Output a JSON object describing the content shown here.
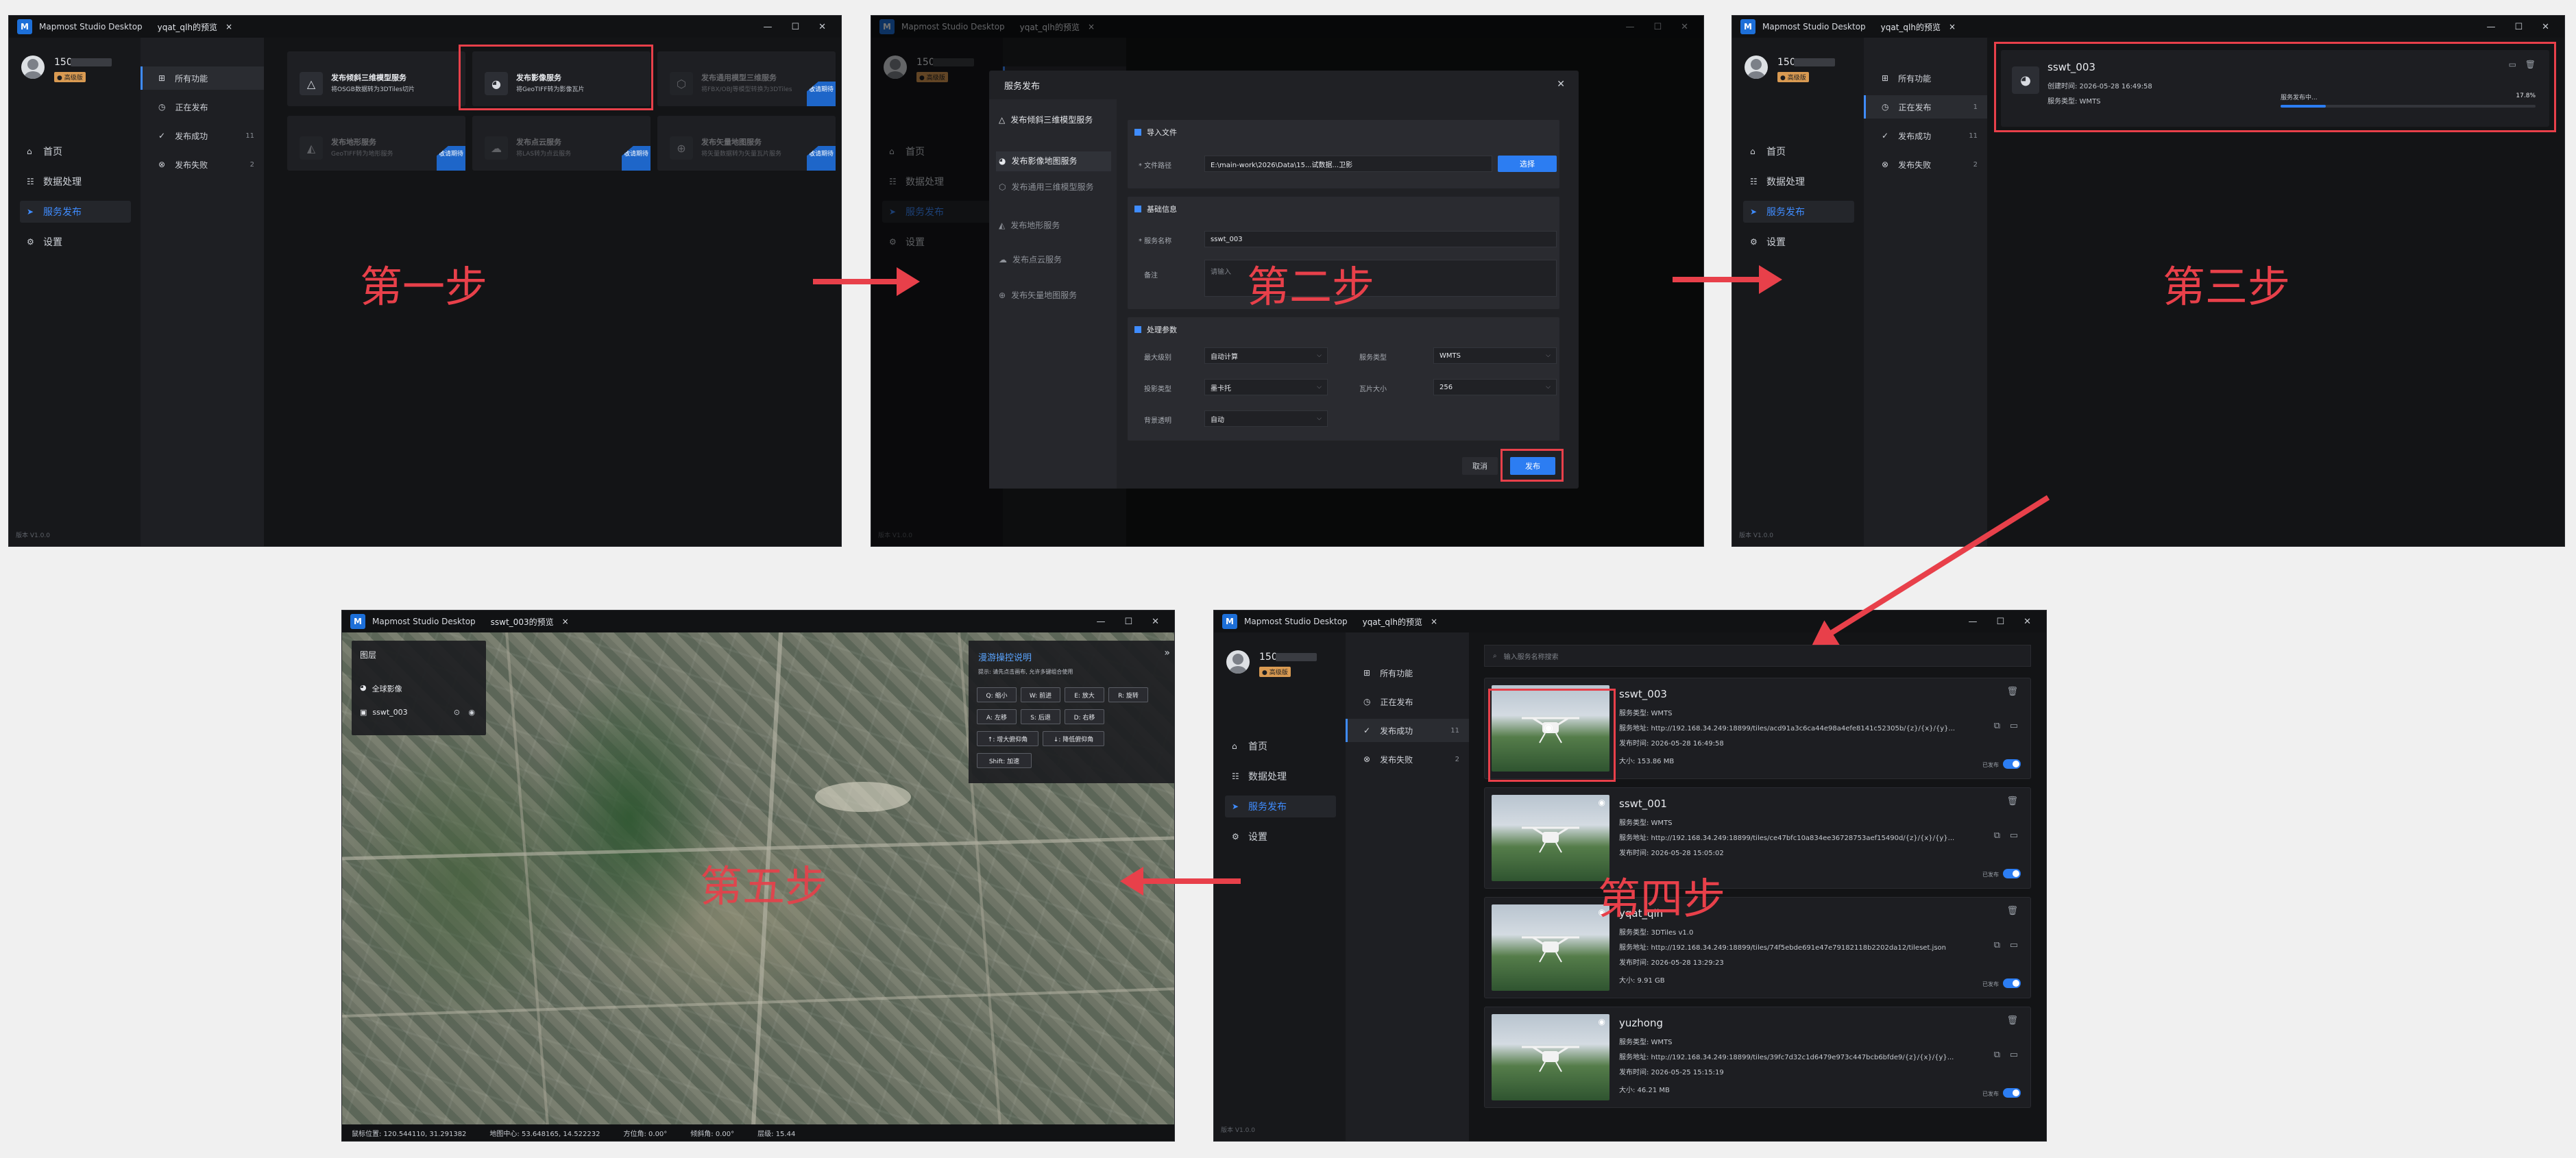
{
  "app": {
    "name": "Mapmost Studio Desktop",
    "logo": "M"
  },
  "tabs": {
    "preview_qlh": "yqat_qlh的预览",
    "preview_sswt": "sswt_003的预览",
    "close": "×"
  },
  "window_controls": {
    "min": "—",
    "max": "☐",
    "close": "✕"
  },
  "user": {
    "name": "150",
    "badge": "● 高级版"
  },
  "nav": {
    "home": "首页",
    "data": "数据处理",
    "publish": "服务发布",
    "settings": "设置"
  },
  "version": "版本 V1.0.0",
  "subnav": {
    "all": "所有功能",
    "publishing": "正在发布",
    "publishing_count": "1",
    "success": "发布成功",
    "success_count": "11",
    "failed": "发布失败",
    "failed_count": "2"
  },
  "cards": [
    {
      "title": "发布倾斜三维模型服务",
      "desc": "将OSGB数据转为3DTiles切片"
    },
    {
      "title": "发布影像服务",
      "desc": "将GeoTIFF转为影像瓦片"
    },
    {
      "title": "发布通用模型三维服务",
      "desc": "将FBX/OBJ等模型转换为3DTiles"
    },
    {
      "title": "发布地形服务",
      "desc": "GeoTIFF转为地形服务"
    },
    {
      "title": "发布点云服务",
      "desc": "将LAS转为点云服务"
    },
    {
      "title": "发布矢量地图服务",
      "desc": "将矢量数据转为矢量瓦片服务"
    }
  ],
  "soon_badge": "敬请期待",
  "steps": [
    "第一步",
    "第二步",
    "第三步",
    "第四步",
    "第五步"
  ],
  "dialog": {
    "title": "服务发布",
    "close": "✕",
    "menu": [
      "发布倾斜三维模型服务",
      "发布影像地图服务",
      "发布通用三维模型服务",
      "发布地形服务",
      "发布点云服务",
      "发布矢量地图服务"
    ],
    "import_title": "导入文件",
    "file_label": "* 文件路径",
    "file_value": "E:\\main-work\\2026\\Data\\15...试数据...卫影",
    "choose": "选择",
    "basic_title": "基础信息",
    "name_label": "* 服务名称",
    "name_value": "sswt_003",
    "note_label": "备注",
    "note_placeholder": "请输入",
    "params_title": "处理参数",
    "max_level_label": "最大级别",
    "max_level_value": "自动计算",
    "service_type_label": "服务类型",
    "service_type_value": "WMTS",
    "proj_label": "投影类型",
    "proj_value": "墨卡托",
    "tile_label": "瓦片大小",
    "tile_value": "256",
    "bg_label": "背景透明",
    "bg_value": "自动",
    "cancel": "取消",
    "publish": "发布"
  },
  "progress_task": {
    "name": "sswt_003",
    "created": "创建时间: 2026-05-28 16:49:58",
    "type": "服务类型: WMTS",
    "status": "服务发布中...",
    "percent_text": "17.8%",
    "progress": 0.178
  },
  "search_placeholder": "输入服务名称搜索",
  "services": [
    {
      "name": "sswt_003",
      "type": "服务类型:  WMTS",
      "url": "服务地址:  http://192.168.34.249:18899/tiles/acd91a3c6ca44e98a4efe8141c52305b/{z}/{x}/{y}...",
      "time": "发布时间:  2026-05-28 16:49:58",
      "size": "大小:  153.86 MB"
    },
    {
      "name": "sswt_001",
      "type": "服务类型:  WMTS",
      "url": "服务地址:  http://192.168.34.249:18899/tiles/ce47bfc10a834ee36728753aef15490d/{z}/{x}/{y}...",
      "time": "发布时间:  2026-05-28 15:05:02",
      "size": ""
    },
    {
      "name": "yqat_qlh",
      "type": "服务类型:  3DTiles v1.0",
      "url": "服务地址:  http://192.168.34.249:18899/tiles/74f5ebde691e47e79182118b2202da12/tileset.json",
      "time": "发布时间:  2026-05-28 13:29:23",
      "size": "大小:  9.91 GB"
    },
    {
      "name": "yuzhong",
      "type": "服务类型:  WMTS",
      "url": "服务地址:  http://192.168.34.249:18899/tiles/39fc7d32c1d6479e973c447bcb6bfde9/{z}/{x}/{y}...",
      "time": "发布时间:  2026-05-25 15:15:19",
      "size": "大小:  46.21 MB"
    }
  ],
  "published_label": "已发布",
  "map": {
    "layer_panel_title": "图层",
    "layers": [
      "全球影像",
      "sswt_003"
    ],
    "help_title": "漫游操控说明",
    "help_hint": "提示: 请先点击画布, 允许多键组合使用",
    "keys": [
      "Q: 缩小",
      "W: 前进",
      "E: 放大",
      "R: 旋转",
      "A: 左移",
      "S: 后退",
      "D: 右移",
      "↑: 增大俯仰角",
      "↓: 降低俯仰角",
      "Shift: 加速"
    ],
    "status": {
      "mouse": "鼠标位置: 120.544110, 31.291382",
      "center": "地图中心: 53.648165, 14.522232",
      "bearing": "方位角: 0.00°",
      "pitch": "倾斜角: 0.00°",
      "zoom": "层级: 15.44"
    }
  }
}
